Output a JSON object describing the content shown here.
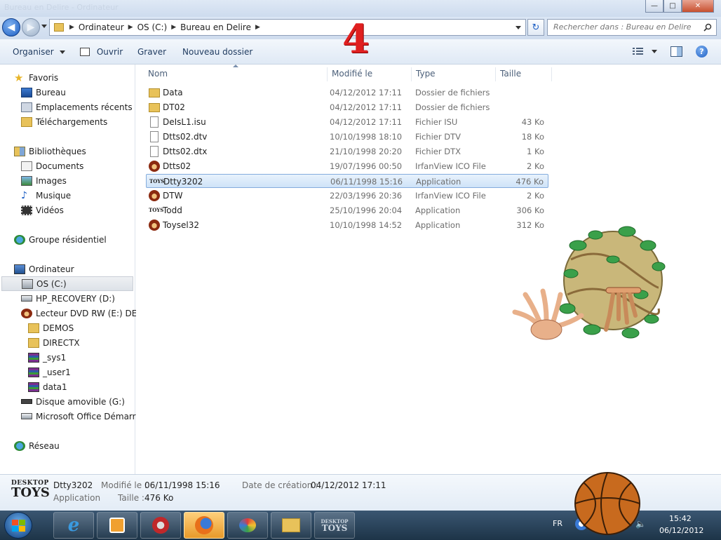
{
  "window": {
    "title": "Bureau en Delire - Ordinateur",
    "minimize_label": "—",
    "maximize_label": "□",
    "close_label": "✕"
  },
  "address": {
    "crumbs": [
      "Ordinateur",
      "OS (C:)",
      "Bureau en Delire"
    ],
    "search_placeholder": "Rechercher dans : Bureau en Delire"
  },
  "overlay_number": "4",
  "toolbar": {
    "organize": "Organiser",
    "open": "Ouvrir",
    "burn": "Graver",
    "new_folder": "Nouveau dossier"
  },
  "sidebar": {
    "favorites": "Favoris",
    "desktop": "Bureau",
    "recent": "Emplacements récents",
    "downloads": "Téléchargements",
    "libraries": "Bibliothèques",
    "documents": "Documents",
    "images": "Images",
    "music": "Musique",
    "videos": "Vidéos",
    "homegroup": "Groupe résidentiel",
    "computer": "Ordinateur",
    "os_c": "OS (C:)",
    "hp_recovery": "HP_RECOVERY (D:)",
    "dvd": "Lecteur DVD RW (E:) DELIR",
    "demos": "DEMOS",
    "directx": "DIRECTX",
    "sys1": "_sys1",
    "user1": "_user1",
    "data1": "data1",
    "removable": "Disque amovible (G:)",
    "office": "Microsoft Office Démarrer",
    "network": "Réseau"
  },
  "columns": {
    "name": "Nom",
    "modified": "Modifié le",
    "type": "Type",
    "size": "Taille"
  },
  "files": [
    {
      "name": "Data",
      "date": "04/12/2012 17:11",
      "type": "Dossier de fichiers",
      "size": "",
      "icon": "folder-icon"
    },
    {
      "name": "DT02",
      "date": "04/12/2012 17:11",
      "type": "Dossier de fichiers",
      "size": "",
      "icon": "folder-icon"
    },
    {
      "name": "DeIsL1.isu",
      "date": "04/12/2012 17:11",
      "type": "Fichier ISU",
      "size": "43 Ko",
      "icon": "file-icon"
    },
    {
      "name": "Dtts02.dtv",
      "date": "10/10/1998 18:10",
      "type": "Fichier DTV",
      "size": "18 Ko",
      "icon": "file-icon"
    },
    {
      "name": "Dtts02.dtx",
      "date": "21/10/1998 20:20",
      "type": "Fichier DTX",
      "size": "1 Ko",
      "icon": "file-icon"
    },
    {
      "name": "Dtts02",
      "date": "19/07/1996 00:50",
      "type": "IrfanView ICO File",
      "size": "2 Ko",
      "icon": "bear-icon"
    },
    {
      "name": "Dtty3202",
      "date": "06/11/1998 15:16",
      "type": "Application",
      "size": "476 Ko",
      "icon": "toys-icon"
    },
    {
      "name": "DTW",
      "date": "22/03/1996 20:36",
      "type": "IrfanView ICO File",
      "size": "2 Ko",
      "icon": "bear-icon"
    },
    {
      "name": "Todd",
      "date": "25/10/1996 20:04",
      "type": "Application",
      "size": "306 Ko",
      "icon": "toys-icon"
    },
    {
      "name": "Toysel32",
      "date": "10/10/1998 14:52",
      "type": "Application",
      "size": "312 Ko",
      "icon": "bear-icon"
    }
  ],
  "details": {
    "logo_line1": "DESKTOP",
    "logo_line2": "TOYS",
    "name": "Dtty3202",
    "kind": "Application",
    "modified_label": "Modifié le :",
    "modified_value": "06/11/1998 15:16",
    "size_label": "Taille :",
    "size_value": "476 Ko",
    "created_label": "Date de création :",
    "created_value": "04/12/2012 17:11"
  },
  "taskbar": {
    "lang": "FR",
    "time": "15:42",
    "date": "06/12/2012",
    "toys_line1": "DESKTOP",
    "toys_line2": "TOYS"
  },
  "colors": {
    "selection_border": "#84acdd",
    "folder": "#e8c25a",
    "overlay_red": "#e02020"
  }
}
